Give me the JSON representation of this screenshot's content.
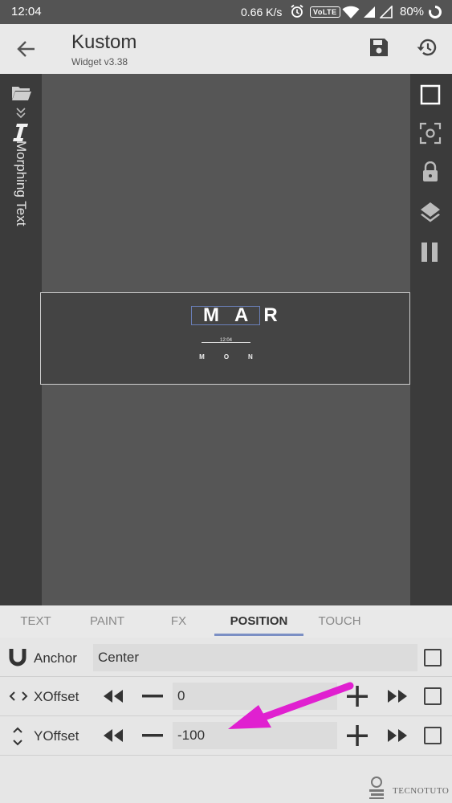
{
  "status_bar": {
    "time": "12:04",
    "net_speed": "0.66 K/s",
    "volte": "VoLTE",
    "battery": "80%"
  },
  "app_bar": {
    "title": "Kustom",
    "subtitle": "Widget v3.38"
  },
  "editor": {
    "left_rail_label": "Morphing Text",
    "widget": {
      "month": "MAR",
      "time": "12:04",
      "day": "MON"
    }
  },
  "tabs": [
    "TEXT",
    "PAINT",
    "FX",
    "POSITION",
    "TOUCH"
  ],
  "active_tab": "POSITION",
  "properties": {
    "anchor": {
      "label": "Anchor",
      "value": "Center"
    },
    "xoffset": {
      "label": "XOffset",
      "value": "0"
    },
    "yoffset": {
      "label": "YOffset",
      "value": "-100"
    }
  },
  "watermark": "TECNOTUTO",
  "colors": {
    "accent": "#7b8fc4",
    "annotation_arrow": "#e020d0"
  }
}
